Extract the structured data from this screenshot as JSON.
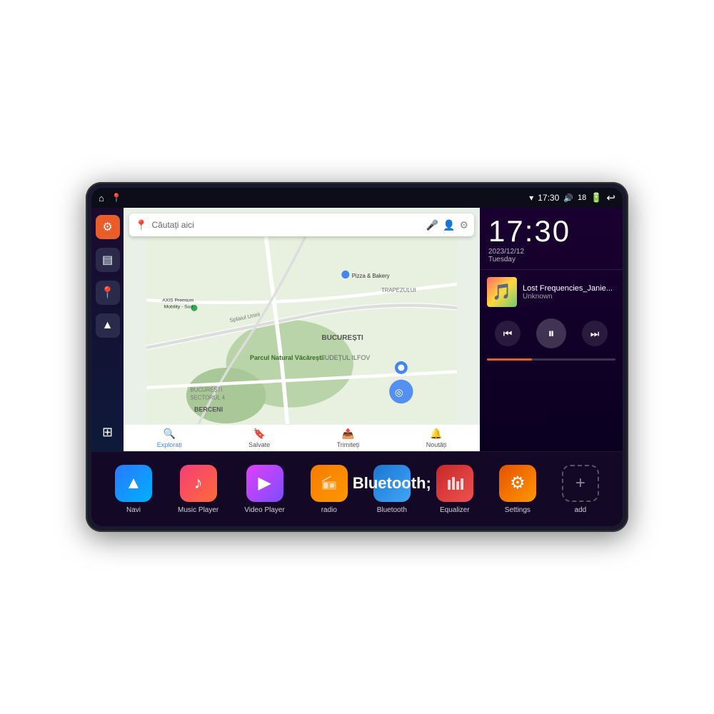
{
  "device": {
    "status_bar": {
      "left_icons": [
        "home",
        "location"
      ],
      "wifi_icon": "wifi",
      "time": "17:30",
      "volume_icon": "volume",
      "battery_level": "18",
      "battery_icon": "battery",
      "back_icon": "back"
    },
    "clock": {
      "time": "17:30",
      "date": "2023/12/12",
      "day": "Tuesday"
    },
    "music": {
      "track_name": "Lost Frequencies_Janie...",
      "artist": "Unknown",
      "progress": "35"
    },
    "map": {
      "search_placeholder": "Căutați aici",
      "nav_items": [
        {
          "label": "Explorați",
          "icon": "🔍"
        },
        {
          "label": "Salvate",
          "icon": "🔖"
        },
        {
          "label": "Trimiteți",
          "icon": "📤"
        },
        {
          "label": "Noutăți",
          "icon": "🔔"
        }
      ],
      "locations": [
        "AXIS Premium Mobility - Sud",
        "Pizza & Bakery",
        "Parcul Natural Văcărești",
        "BUCUREȘTI SECTORUL 4",
        "BUCUREȘTI",
        "JUDEȚUL ILFOV",
        "BERCENI",
        "TRAPEZULUI"
      ]
    },
    "apps": [
      {
        "id": "navi",
        "label": "Navi",
        "icon": "▲",
        "color_class": "app-navi"
      },
      {
        "id": "music-player",
        "label": "Music Player",
        "icon": "🎵",
        "color_class": "app-music"
      },
      {
        "id": "video-player",
        "label": "Video Player",
        "icon": "▶",
        "color_class": "app-video"
      },
      {
        "id": "radio",
        "label": "radio",
        "icon": "📻",
        "color_class": "app-radio"
      },
      {
        "id": "bluetooth",
        "label": "Bluetooth",
        "icon": "Ƀ",
        "color_class": "app-bluetooth"
      },
      {
        "id": "equalizer",
        "label": "Equalizer",
        "icon": "⚡",
        "color_class": "app-equalizer"
      },
      {
        "id": "settings",
        "label": "Settings",
        "icon": "⚙",
        "color_class": "app-settings"
      },
      {
        "id": "add",
        "label": "add",
        "icon": "+",
        "color_class": "app-add"
      }
    ],
    "sidebar": {
      "items": [
        {
          "id": "settings",
          "icon": "⚙",
          "type": "orange"
        },
        {
          "id": "files",
          "icon": "📁",
          "type": "dark"
        },
        {
          "id": "location",
          "icon": "📍",
          "type": "dark"
        },
        {
          "id": "navigation",
          "icon": "▲",
          "type": "dark"
        },
        {
          "id": "apps-grid",
          "icon": "⊞",
          "type": "apps"
        }
      ]
    }
  }
}
